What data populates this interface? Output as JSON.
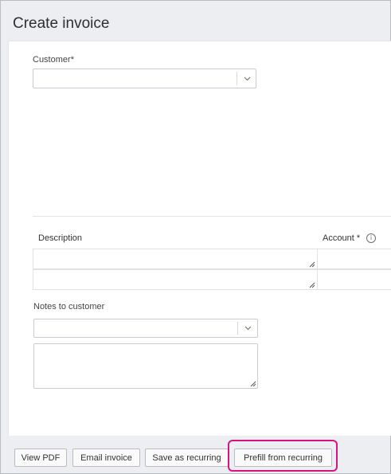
{
  "page": {
    "title": "Create invoice"
  },
  "form": {
    "customer_label": "Customer",
    "required_marker": "*",
    "customer_value": ""
  },
  "lines": {
    "columns": {
      "description": "Description",
      "account": "Account"
    },
    "rows": [
      {
        "description": "",
        "account": ""
      },
      {
        "description": "",
        "account": ""
      }
    ]
  },
  "notes": {
    "label": "Notes to customer",
    "select_value": "",
    "text": ""
  },
  "footer": {
    "view_pdf": "View PDF",
    "email_invoice": "Email invoice",
    "save_recurring": "Save as recurring",
    "prefill_recurring": "Prefill from recurring"
  },
  "highlight_color": "#d6137f"
}
